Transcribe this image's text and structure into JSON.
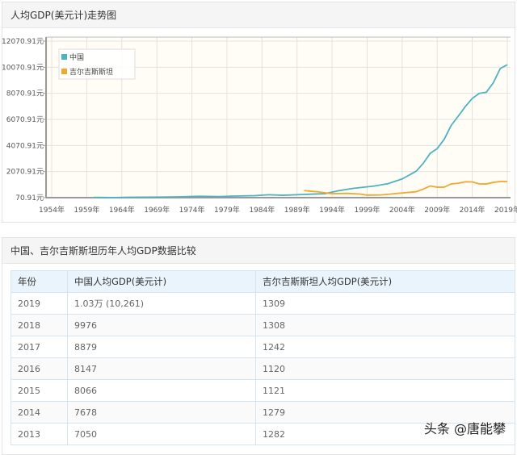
{
  "chart_panel": {
    "title": "人均GDP(美元计)走势图"
  },
  "chart_data": {
    "type": "line",
    "title": "人均GDP(美元计)走势图",
    "y_ticks": [
      "70.91元",
      "2070.91元",
      "4070.91元",
      "6070.91元",
      "8070.91元",
      "10070.91元",
      "12070.91元"
    ],
    "y_tick_values": [
      70.91,
      2070.91,
      4070.91,
      6070.91,
      8070.91,
      10070.91,
      12070.91
    ],
    "x_ticks": [
      "1954年",
      "1959年",
      "1964年",
      "1969年",
      "1974年",
      "1979年",
      "1984年",
      "1989年",
      "1994年",
      "1999年",
      "2004年",
      "2009年",
      "2014年",
      "2019年"
    ],
    "x_tick_values": [
      1954,
      1959,
      1964,
      1969,
      1974,
      1979,
      1984,
      1989,
      1994,
      1999,
      2004,
      2009,
      2014,
      2019
    ],
    "ylim": [
      70.91,
      12070.91
    ],
    "xlim": [
      1954,
      2019
    ],
    "grid": true,
    "legend_position": "top-left",
    "series": [
      {
        "name": "中国",
        "color": "#4fb3bf",
        "x": [
          1960,
          1963,
          1965,
          1970,
          1972,
          1975,
          1978,
          1980,
          1983,
          1985,
          1987,
          1990,
          1993,
          1995,
          1997,
          2000,
          2002,
          2004,
          2006,
          2007,
          2008,
          2009,
          2010,
          2011,
          2012,
          2013,
          2014,
          2015,
          2016,
          2017,
          2018,
          2019
        ],
        "values": [
          90,
          75,
          98,
          113,
          133,
          178,
          156,
          195,
          226,
          294,
          252,
          318,
          377,
          609,
          781,
          959,
          1148,
          1508,
          2099,
          2694,
          3468,
          3832,
          4550,
          5618,
          6317,
          7050,
          7678,
          8066,
          8147,
          8879,
          9976,
          10261
        ]
      },
      {
        "name": "吉尔吉斯斯坦",
        "color": "#f0a830",
        "x": [
          1990,
          1992,
          1994,
          1996,
          1998,
          1999,
          2001,
          2003,
          2005,
          2006,
          2007,
          2008,
          2009,
          2010,
          2011,
          2012,
          2013,
          2014,
          2015,
          2016,
          2017,
          2018,
          2019
        ],
        "values": [
          610,
          520,
          370,
          400,
          350,
          260,
          280,
          380,
          476,
          530,
          722,
          966,
          871,
          880,
          1124,
          1178,
          1282,
          1279,
          1121,
          1120,
          1242,
          1308,
          1309
        ]
      }
    ]
  },
  "table_panel": {
    "title": "中国、吉尔吉斯斯坦历年人均GDP数据比较"
  },
  "table": {
    "headers": [
      "年份",
      "中国人均GDP(美元计)",
      "吉尔吉斯斯坦人均GDP(美元计)"
    ],
    "rows": [
      [
        "2019",
        "1.03万 (10,261)",
        "1309"
      ],
      [
        "2018",
        "9976",
        "1308"
      ],
      [
        "2017",
        "8879",
        "1242"
      ],
      [
        "2016",
        "8147",
        "1120"
      ],
      [
        "2015",
        "8066",
        "1121"
      ],
      [
        "2014",
        "7678",
        "1279"
      ],
      [
        "2013",
        "7050",
        "1282"
      ]
    ]
  },
  "watermark": "头条 @唐能攀"
}
